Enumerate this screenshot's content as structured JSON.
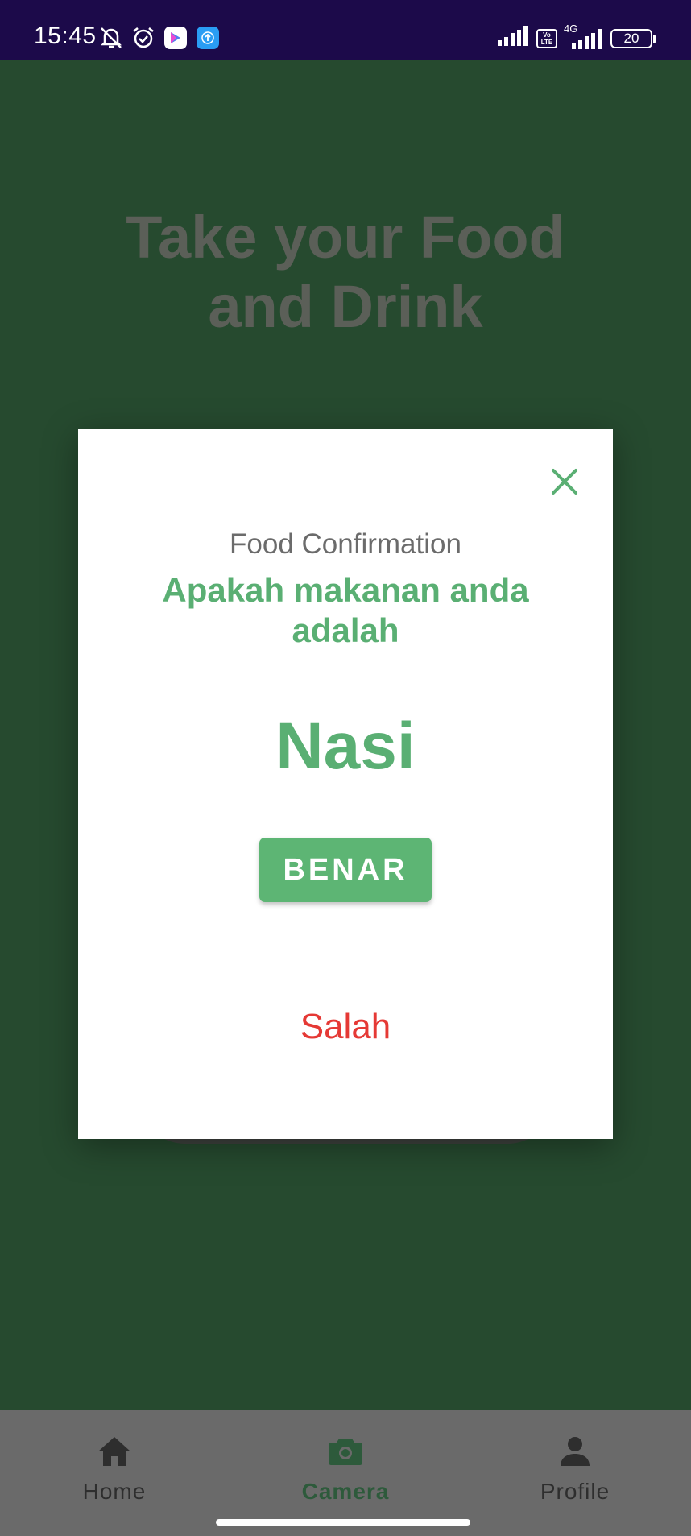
{
  "status_bar": {
    "time": "15:45",
    "network": "4G",
    "volte_top": "Vo",
    "volte_bottom": "LTE",
    "battery": "20",
    "icons": [
      "mute-icon",
      "alarm-icon",
      "play-store-icon",
      "upload-icon",
      "signal-icon",
      "volte-icon",
      "signal-4g-icon",
      "battery-icon"
    ]
  },
  "page": {
    "title_line1": "Take your Food",
    "title_line2": "and Drink"
  },
  "modal": {
    "label": "Food Confirmation",
    "question": "Apakah makanan anda adalah",
    "food_name": "Nasi",
    "confirm_label": "BENAR",
    "reject_label": "Salah",
    "close_icon": "close-icon"
  },
  "nav": {
    "items": [
      {
        "label": "Home",
        "icon": "home-icon",
        "active": false
      },
      {
        "label": "Camera",
        "icon": "camera-icon",
        "active": true
      },
      {
        "label": "Profile",
        "icon": "person-icon",
        "active": false
      }
    ]
  },
  "colors": {
    "status_bar_bg": "#1c0a4a",
    "screen_bg": "#264a2f",
    "accent_green": "#5aaf73",
    "button_green": "#5db574",
    "reject_red": "#e53935",
    "nav_bg": "#6a6a6a",
    "nav_active": "#2d5a3b"
  }
}
